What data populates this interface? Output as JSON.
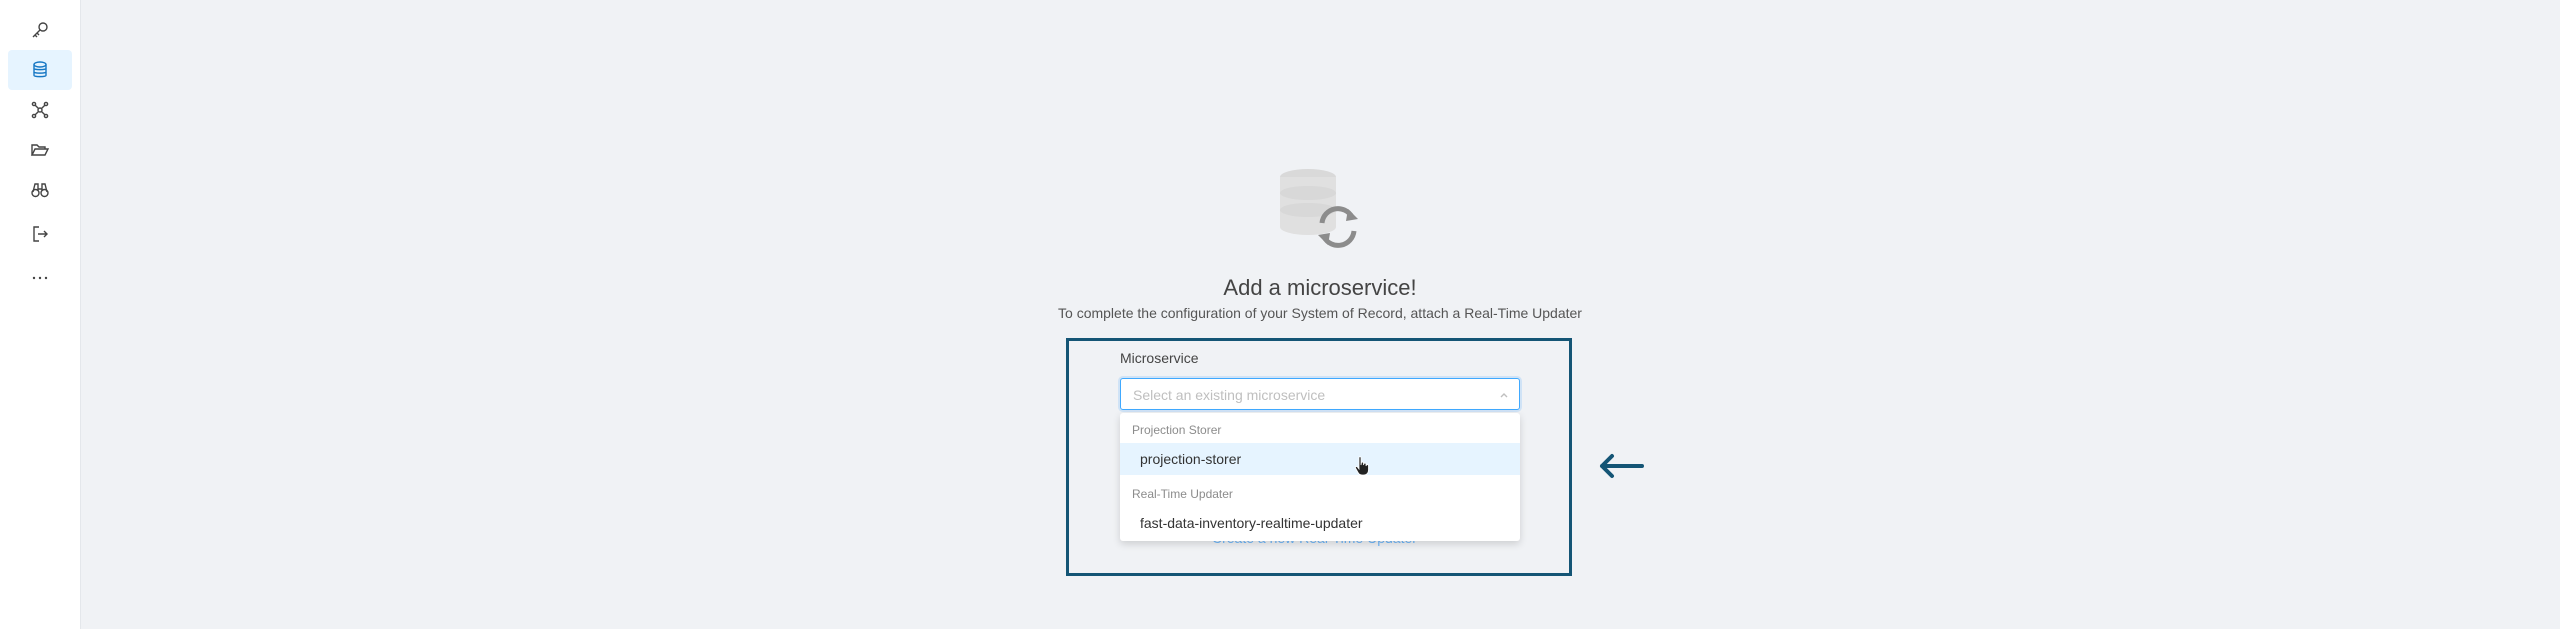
{
  "sidebar": {
    "items": [
      {
        "icon": "key-icon",
        "active": false
      },
      {
        "icon": "database-icon",
        "active": true
      },
      {
        "icon": "network-icon",
        "active": false
      },
      {
        "icon": "folder-open-icon",
        "active": false
      },
      {
        "icon": "binoculars-icon",
        "active": false
      },
      {
        "icon": "sign-out-icon",
        "active": false
      },
      {
        "icon": "more-icon",
        "active": false
      }
    ]
  },
  "empty_state": {
    "title": "Add a microservice!",
    "subtitle": "To complete the configuration of your System of Record, attach a Real-Time Updater"
  },
  "form": {
    "field_label": "Microservice",
    "select_placeholder": "Select an existing microservice",
    "dropdown": {
      "groups": [
        {
          "label": "Projection Storer",
          "options": [
            "projection-storer"
          ]
        },
        {
          "label": "Real-Time Updater",
          "options": [
            "fast-data-inventory-realtime-updater"
          ]
        }
      ]
    },
    "partially_hidden_link": "Create a new Real-Time Updater"
  },
  "colors": {
    "highlight_border": "#145575",
    "accent": "#1890ff",
    "option_hover": "#e6f4ff",
    "sidebar_active": "#e6f4ff"
  }
}
